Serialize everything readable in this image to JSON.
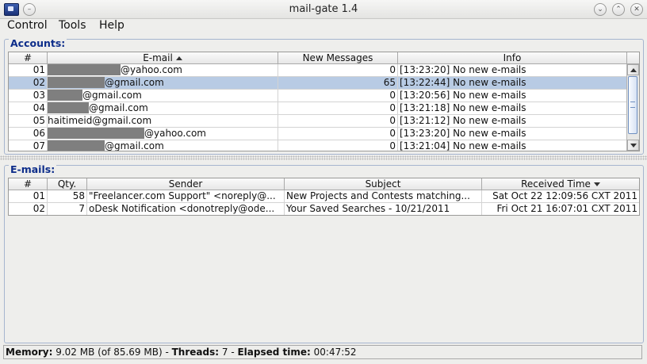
{
  "window": {
    "title": "mail-gate 1.4"
  },
  "menu": {
    "items": [
      "Control",
      "Tools",
      "Help"
    ]
  },
  "accounts": {
    "title": "Accounts:",
    "columns": [
      "#",
      "E-mail",
      "New Messages",
      "Info"
    ],
    "rows": [
      {
        "num": "01",
        "email": "@yahoo.com",
        "redact": 92,
        "count": "0",
        "info": "[13:23:20] No new e-mails"
      },
      {
        "num": "02",
        "email": "@gmail.com",
        "redact": 72,
        "count": "65",
        "info": "[13:22:44] No new e-mails",
        "selected": true
      },
      {
        "num": "03",
        "email": "@gmail.com",
        "redact": 44,
        "count": "0",
        "info": "[13:20:56] No new e-mails"
      },
      {
        "num": "04",
        "email": "@gmail.com",
        "redact": 52,
        "count": "0",
        "info": "[13:21:18] No new e-mails"
      },
      {
        "num": "05",
        "email": "haitimeid@gmail.com",
        "redact": 0,
        "count": "0",
        "info": "[13:21:12] No new e-mails"
      },
      {
        "num": "06",
        "email": "@yahoo.com",
        "redact": 122,
        "count": "0",
        "info": "[13:23:20] No new e-mails"
      },
      {
        "num": "07",
        "email": "@gmail.com",
        "redact": 72,
        "count": "0",
        "info": "[13:21:04] No new e-mails"
      }
    ]
  },
  "emails": {
    "title": "E-mails:",
    "columns": [
      "#",
      "Qty.",
      "Sender",
      "Subject",
      "Received Time"
    ],
    "rows": [
      {
        "num": "01",
        "qty": "58",
        "sender": "\"Freelancer.com Support\" <noreply@...",
        "subject": "New Projects and Contests matching...",
        "time": "Sat Oct 22 12:09:56 CXT 2011"
      },
      {
        "num": "02",
        "qty": "7",
        "sender": "oDesk Notification <donotreply@ode...",
        "subject": "Your Saved Searches - 10/21/2011",
        "time": "Fri Oct 21 16:07:01 CXT 2011"
      }
    ]
  },
  "status": {
    "memory_label": "Memory:",
    "memory_value": "9.02 MB (of 85.69 MB)",
    "sep1": " - ",
    "threads_label": "Threads:",
    "threads_value": "7",
    "sep2": " - ",
    "elapsed_label": "Elapsed time:",
    "elapsed_value": "00:47:52"
  },
  "colors": {
    "selection": "#b8cbe4",
    "group_title": "#0d2d8a",
    "redaction": "#7f7f7f"
  },
  "icons": [
    "app-icon",
    "minimize-icon",
    "maximize-icon",
    "close-icon",
    "sort-ascending-icon",
    "sort-descending-icon",
    "scroll-up-icon",
    "scroll-down-icon"
  ]
}
